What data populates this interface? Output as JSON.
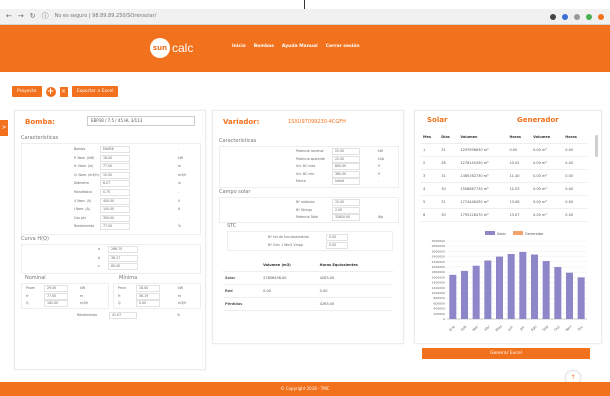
{
  "browser": {
    "url": "No es seguro | 98.89.89.250/SOrensolar/"
  },
  "header": {
    "logo_sun": "sun",
    "logo_calc": "calc",
    "nav": [
      "Inicio",
      "Bombas",
      "Ayuda Manual",
      "Cerrar sesión"
    ]
  },
  "toolbar": {
    "proyecto_label": "Proyecto",
    "add_label": "+",
    "delete_label": "×",
    "export_label": "Exportar a Excel",
    "side_tab": ">"
  },
  "bomba": {
    "title": "Bomba:",
    "select_value": "EBP38 / 7.5 / 45 HL 3/113",
    "caracteristicas_title": "Características",
    "caracteristicas": [
      {
        "label": "Bomba",
        "value": "EbHR8",
        "unit": "-"
      },
      {
        "label": "P. Nom. (kW)",
        "value": "18.00",
        "unit": "kW"
      },
      {
        "label": "H. Nom. (m)",
        "value": "77.00",
        "unit": "m"
      },
      {
        "label": "Q. Nom. (m3/h)",
        "value": "15.00",
        "unit": "m3/h"
      },
      {
        "label": "Diámetro",
        "value": "6.27",
        "unit": "in"
      },
      {
        "label": "Monofásica",
        "value": "0.75",
        "unit": "-"
      },
      {
        "label": "V Nom. (V)",
        "value": "400.00",
        "unit": "V"
      },
      {
        "label": "I Nom. (A)",
        "value": "100.00",
        "unit": "A"
      },
      {
        "label": "Cos phi",
        "value": "300.00",
        "unit": "-"
      },
      {
        "label": "Rendimiento",
        "value": "77.00",
        "unit": "%"
      }
    ],
    "curva_title": "Curva H(Q)",
    "curva": [
      {
        "label": "a",
        "value": "266.75"
      },
      {
        "label": "b",
        "value": "36.17"
      },
      {
        "label": "c",
        "value": "80.00"
      }
    ],
    "nominal_title": "Nominal",
    "nominal": [
      {
        "label": "Pnom",
        "value": "29.00",
        "unit": "kW"
      },
      {
        "label": "H",
        "value": "77.00",
        "unit": "m"
      },
      {
        "label": "Q",
        "value": "182.00",
        "unit": "m3/h"
      }
    ],
    "minima_title": "Mínima",
    "minima": [
      {
        "label": "Pmin",
        "value": "18.00",
        "unit": "kW"
      },
      {
        "label": "H",
        "value": "56.19",
        "unit": "m"
      },
      {
        "label": "Q",
        "value": "0.00",
        "unit": "m3/h"
      }
    ],
    "rendimiento_label": "Rendimiento",
    "rendimiento_value": "41.07",
    "rendimiento_unit": "%"
  },
  "variador": {
    "title": "Variador:",
    "model": "1SXU97099230-4CGFH",
    "caracteristicas_title": "Características",
    "caracteristicas": [
      {
        "label": "Potencia nominal",
        "value": "22.00",
        "unit": "kW"
      },
      {
        "label": "Potencia aparente",
        "value": "22.00",
        "unit": "kVA"
      },
      {
        "label": "Vcc DC max",
        "value": "800.00",
        "unit": "V"
      },
      {
        "label": "Vcc DC min",
        "value": "380.00",
        "unit": "V"
      },
      {
        "label": "Marca",
        "value": "Infeld",
        "unit": "-"
      }
    ],
    "campo_title": "Campo solar",
    "campo": [
      {
        "label": "Nº módulos",
        "value": "22.00",
        "unit": ""
      },
      {
        "label": "Nº Strings",
        "value": "2.00",
        "unit": ""
      },
      {
        "label": "Potencia Total",
        "value": "32800.00",
        "unit": "Wp"
      }
    ],
    "stc_title": "STC",
    "stc": [
      {
        "label": "Nº hrs de funcionamiento",
        "value": "0.00"
      },
      {
        "label": "Nº Crec 1 Wm2 Vmpp",
        "value": "0.00"
      }
    ],
    "vol_header": [
      "",
      "Volumen (m3)",
      "Horas Equivalentes"
    ],
    "vol_rows": [
      {
        "label": "Solar",
        "volumen": "27856436.00",
        "horas": "4263.00"
      },
      {
        "label": "Red",
        "volumen": "0.00",
        "horas": "0.00"
      },
      {
        "label": "Pérdidas",
        "volumen": "",
        "horas": "4263.00"
      }
    ]
  },
  "right": {
    "solar_title": "Solar",
    "generador_title": "Generador",
    "table_header": [
      "Mes",
      "Días",
      "Volumen",
      "Horas",
      "Volumen",
      "Horas"
    ],
    "table_rows": [
      [
        "1",
        "31",
        "1297096830 m³",
        "0.00",
        "0.00 m³",
        "0.00"
      ],
      [
        "2",
        "28",
        "1276145430 m³",
        "10.02",
        "0.00 m³",
        "0.00"
      ],
      [
        "3",
        "31",
        "1485162730 m³",
        "11.40",
        "0.00 m³",
        "0.00"
      ],
      [
        "4",
        "30",
        "1506887730 m³",
        "12.03",
        "0.00 m³",
        "0.00"
      ],
      [
        "5",
        "31",
        "1774446430 m³",
        "13.08",
        "0.00 m³",
        "0.00"
      ],
      [
        "6",
        "30",
        "1755128470 m³",
        "13.07",
        "0.00 m³",
        "0.00"
      ]
    ],
    "generate_label": "Generar Excel"
  },
  "chart_data": {
    "type": "bar",
    "categories": [
      "Ene",
      "Feb",
      "Mar",
      "Abr",
      "May",
      "Jun",
      "Jul",
      "Ago",
      "Sep",
      "Oct",
      "Nov",
      "Dic"
    ],
    "series": [
      {
        "name": "Solar",
        "values": [
          1700000,
          1850000,
          2050000,
          2250000,
          2400000,
          2500000,
          2580000,
          2480000,
          2230000,
          2000000,
          1780000,
          1600000
        ]
      },
      {
        "name": "Generador",
        "values": [
          0,
          0,
          0,
          0,
          0,
          0,
          0,
          0,
          0,
          0,
          0,
          0
        ]
      }
    ],
    "yticks": [
      "3000000",
      "2800000",
      "2600000",
      "2400000",
      "2200000",
      "2000000",
      "1800000",
      "1600000",
      "1400000",
      "1200000",
      "1000000",
      "800000",
      "600000",
      "400000",
      "200000",
      "0"
    ],
    "ylim": [
      0,
      3000000
    ],
    "colors": {
      "solar": "#8d86c9",
      "generador": "#f2a36b"
    }
  },
  "footer": {
    "text": "© Copyright 2018 - TMC"
  },
  "colors": {
    "accent": "#f2711c"
  }
}
